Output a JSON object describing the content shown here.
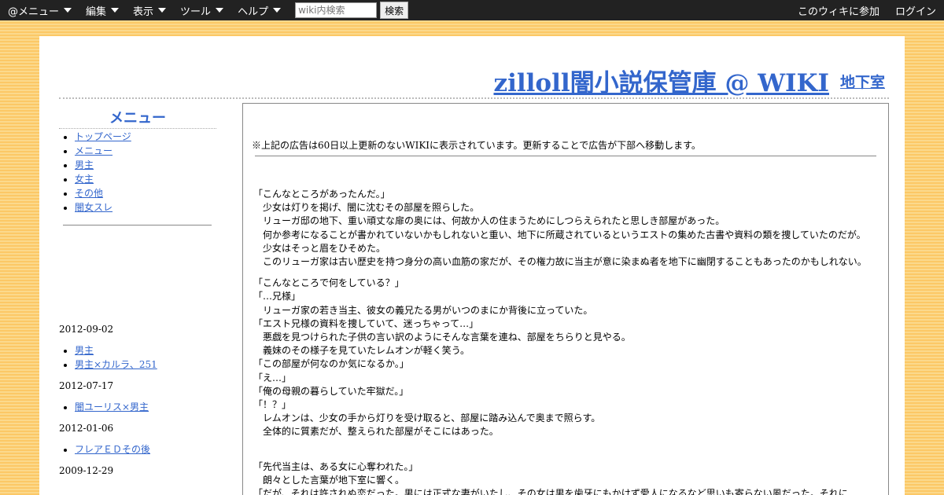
{
  "topbar": {
    "menus": [
      "@メニュー",
      "編集",
      "表示",
      "ツール",
      "ヘルプ"
    ],
    "search_placeholder": "wiki内検索",
    "search_button": "検索",
    "join": "このウィキに参加",
    "login": "ログイン"
  },
  "header": {
    "title": "zilloll闇小説保管庫 @ WIKI",
    "sub_link": "地下室"
  },
  "sidebar": {
    "heading": "メニュー",
    "items": [
      "トップページ",
      "メニュー",
      "男主",
      "女主",
      "その他",
      "闇女スレ"
    ],
    "recent": [
      {
        "date": "2012-09-02",
        "items": [
          "男主",
          "男主×カルラ、251"
        ]
      },
      {
        "date": "2012-07-17",
        "items": [
          "闇ユーリス×男主"
        ]
      },
      {
        "date": "2012-01-06",
        "items": [
          "フレアＥＤその後"
        ]
      },
      {
        "date": "2009-12-29",
        "items": []
      }
    ]
  },
  "main": {
    "notice": "※上記の広告は60日以上更新のないWIKIに表示されています。更新することで広告が下部へ移動します。",
    "paragraphs": [
      [
        "「こんなところがあったんだ。」",
        "　少女は灯りを掲げ、闇に沈むその部屋を照らした。",
        "　リューガ邸の地下、重い頑丈な扉の奥には、何故か人の住まうためにしつらえられたと思しき部屋があった。",
        "　何か参考になることが書かれていないかもしれないと重い、地下に所蔵されているというエストの集めた古書や資料の類を捜していたのだが。",
        "　少女はそっと眉をひそめた。",
        "　このリューガ家は古い歴史を持つ身分の高い血筋の家だが、その権力故に当主が意に染まぬ者を地下に幽閉することもあったのかもしれない。"
      ],
      [
        "「こんなところで何をしている？」",
        "「…兄様」",
        "　リューガ家の若き当主、彼女の義兄たる男がいつのまにか背後に立っていた。",
        "「エスト兄様の資料を捜していて、迷っちゃって…」",
        "　悪戯を見つけられた子供の言い訳のようにそんな言葉を連ね、部屋をちらりと見やる。",
        "　義妹のその様子を見ていたレムオンが軽く笑う。",
        "「この部屋が何なのか気になるか。」",
        "「え…」",
        "「俺の母親の暮らしていた牢獄だ。」",
        "「！？」",
        "　レムオンは、少女の手から灯りを受け取ると、部屋に踏み込んで奥まで照らす。",
        "　全体的に質素だが、整えられた部屋がそこにはあった。"
      ],
      [
        "",
        "「先代当主は、ある女に心奪われた。」",
        "　朗々とした言葉が地下室に響く。",
        "「だが、それは許されぬ恋だった。男には正式な妻がいたし、その女は男を歯牙にもかけず愛人になるなど思いも寄らない風だった。それに…"
      ]
    ]
  }
}
